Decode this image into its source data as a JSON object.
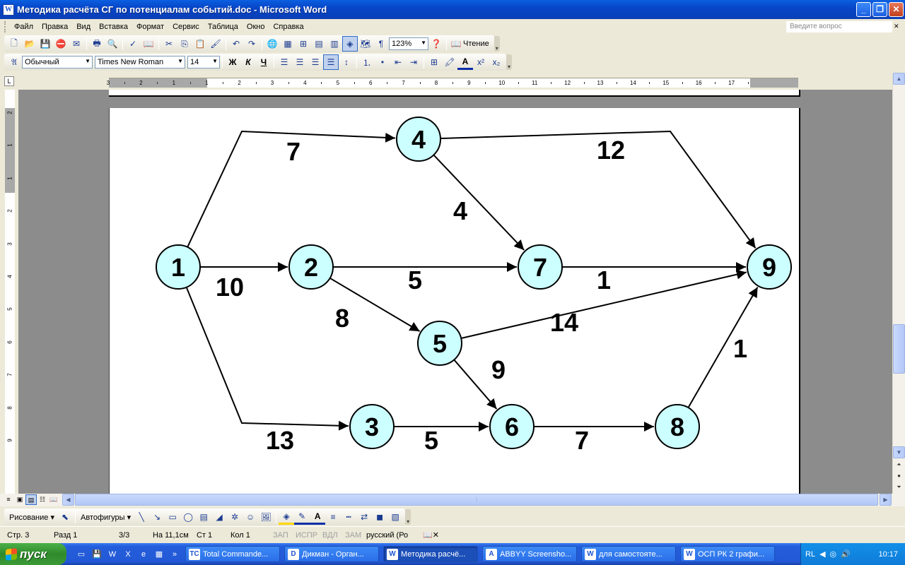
{
  "window": {
    "title": "Методика расчёта СГ по потенциалам событий.doc - Microsoft Word",
    "app_icon": "W"
  },
  "menu": {
    "items": [
      "Файл",
      "Правка",
      "Вид",
      "Вставка",
      "Формат",
      "Сервис",
      "Таблица",
      "Окно",
      "Справка"
    ],
    "ask_placeholder": "Введите вопрос"
  },
  "toolbar": {
    "zoom": "123%",
    "reading_label": "Чтение",
    "style": "Обычный",
    "font": "Times New Roman",
    "size": "14",
    "bold": "Ж",
    "italic": "К",
    "underline": "Ч"
  },
  "ruler": {
    "h_labels": [
      "3",
      "2",
      "1",
      "1",
      "2",
      "3",
      "4",
      "5",
      "6",
      "7",
      "8",
      "9",
      "10",
      "11",
      "12",
      "13",
      "14",
      "15",
      "16",
      "17"
    ],
    "v_labels": [
      "2",
      "1",
      "1",
      "2",
      "3",
      "4",
      "5",
      "6",
      "7",
      "8",
      "9"
    ]
  },
  "diagram": {
    "nodes": [
      {
        "id": "1",
        "label": "1"
      },
      {
        "id": "2",
        "label": "2"
      },
      {
        "id": "3",
        "label": "3"
      },
      {
        "id": "4",
        "label": "4"
      },
      {
        "id": "5",
        "label": "5"
      },
      {
        "id": "6",
        "label": "6"
      },
      {
        "id": "7",
        "label": "7"
      },
      {
        "id": "8",
        "label": "8"
      },
      {
        "id": "9",
        "label": "9"
      }
    ],
    "edges": [
      {
        "from": "1",
        "to": "4",
        "weight": "7"
      },
      {
        "from": "1",
        "to": "2",
        "weight": "10"
      },
      {
        "from": "1",
        "to": "3",
        "weight": "13"
      },
      {
        "from": "4",
        "to": "7",
        "weight": "4"
      },
      {
        "from": "4",
        "to": "9",
        "weight": "12"
      },
      {
        "from": "2",
        "to": "7",
        "weight": "5"
      },
      {
        "from": "2",
        "to": "5",
        "weight": "8"
      },
      {
        "from": "7",
        "to": "9",
        "weight": "1"
      },
      {
        "from": "5",
        "to": "9",
        "weight": "14"
      },
      {
        "from": "5",
        "to": "6",
        "weight": "9"
      },
      {
        "from": "3",
        "to": "6",
        "weight": "5"
      },
      {
        "from": "6",
        "to": "8",
        "weight": "7"
      },
      {
        "from": "8",
        "to": "9",
        "weight": "1"
      }
    ],
    "node_fill": "#ccffff"
  },
  "drawing_toolbar": {
    "draw_label": "Рисование",
    "autoshapes_label": "Автофигуры"
  },
  "status": {
    "page": "Стр. 3",
    "section": "Разд 1",
    "pages": "3/3",
    "at": "На 11,1см",
    "line": "Ст 1",
    "col": "Кол 1",
    "rec": "ЗАП",
    "trk": "ИСПР",
    "ext": "ВДЛ",
    "ovr": "ЗАМ",
    "lang": "русский (Ро"
  },
  "taskbar": {
    "start_label": "пуск",
    "tasks": [
      {
        "label": "Total Commande...",
        "icon": "TC"
      },
      {
        "label": "Дикман - Орган...",
        "icon": "D"
      },
      {
        "label": "Методика расчё...",
        "icon": "W"
      },
      {
        "label": "ABBYY Screensho...",
        "icon": "A"
      },
      {
        "label": "для самостояте...",
        "icon": "W"
      },
      {
        "label": "ОСП РК 2 графи...",
        "icon": "W"
      }
    ],
    "lang": "RL",
    "clock": "10:17"
  }
}
